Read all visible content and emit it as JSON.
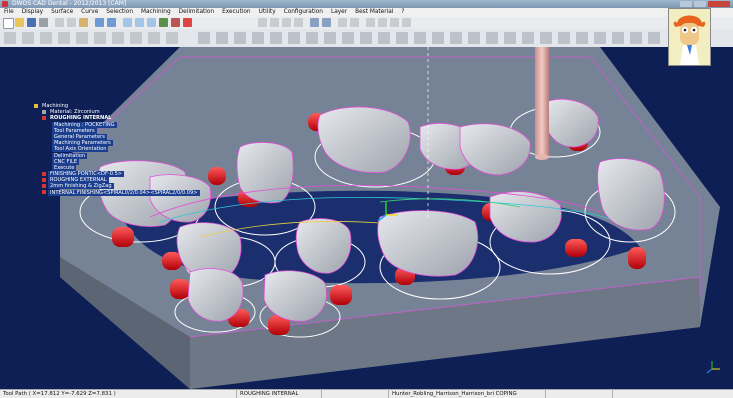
{
  "window": {
    "title": "DWOS CAD Dental - 2012/2013 [CAM]"
  },
  "menu": [
    "File",
    "Display",
    "Surface",
    "Curve",
    "Selection",
    "Machining",
    "Delimitation",
    "Execution",
    "Utility",
    "Configuration",
    "Layer",
    "Best Material",
    "?"
  ],
  "toolbar": {
    "combo_value": ""
  },
  "tree": {
    "root": "Machining",
    "material": "Material: Zirconium",
    "roughing": "ROUGHING INTERNAL",
    "children": [
      "Machining : POCKETING",
      "Tool Parameters",
      "General Parameters",
      "Machining Parameters",
      "Tool Axis Orientation",
      "Delimitation",
      "CNC FILE",
      "Execute"
    ],
    "ops": [
      "FINISHING PONTIC<DF-0.5>",
      "ROUGHING EXTERNAL",
      "2mm finishing & ZigZag",
      "INTERNAL FINISHING<SPIRAL0/2/0.04><SPIRAL2/0/0.09>"
    ]
  },
  "status": {
    "toolpath": "Tool Path ( X=17.812 Y=-7.629 Z=7.831 )",
    "active_op": "ROUGHING INTERNAL",
    "file": "Hunter_Robling_Harrison_Harrison_bri COPING"
  },
  "colors": {
    "viewport_bg": "#0d1f54",
    "block": "#7b8795",
    "tooth": "#c8cbd0",
    "pin": "#e8141a",
    "tool": "#e4b6b2",
    "toolpath": "#e24fd8"
  }
}
